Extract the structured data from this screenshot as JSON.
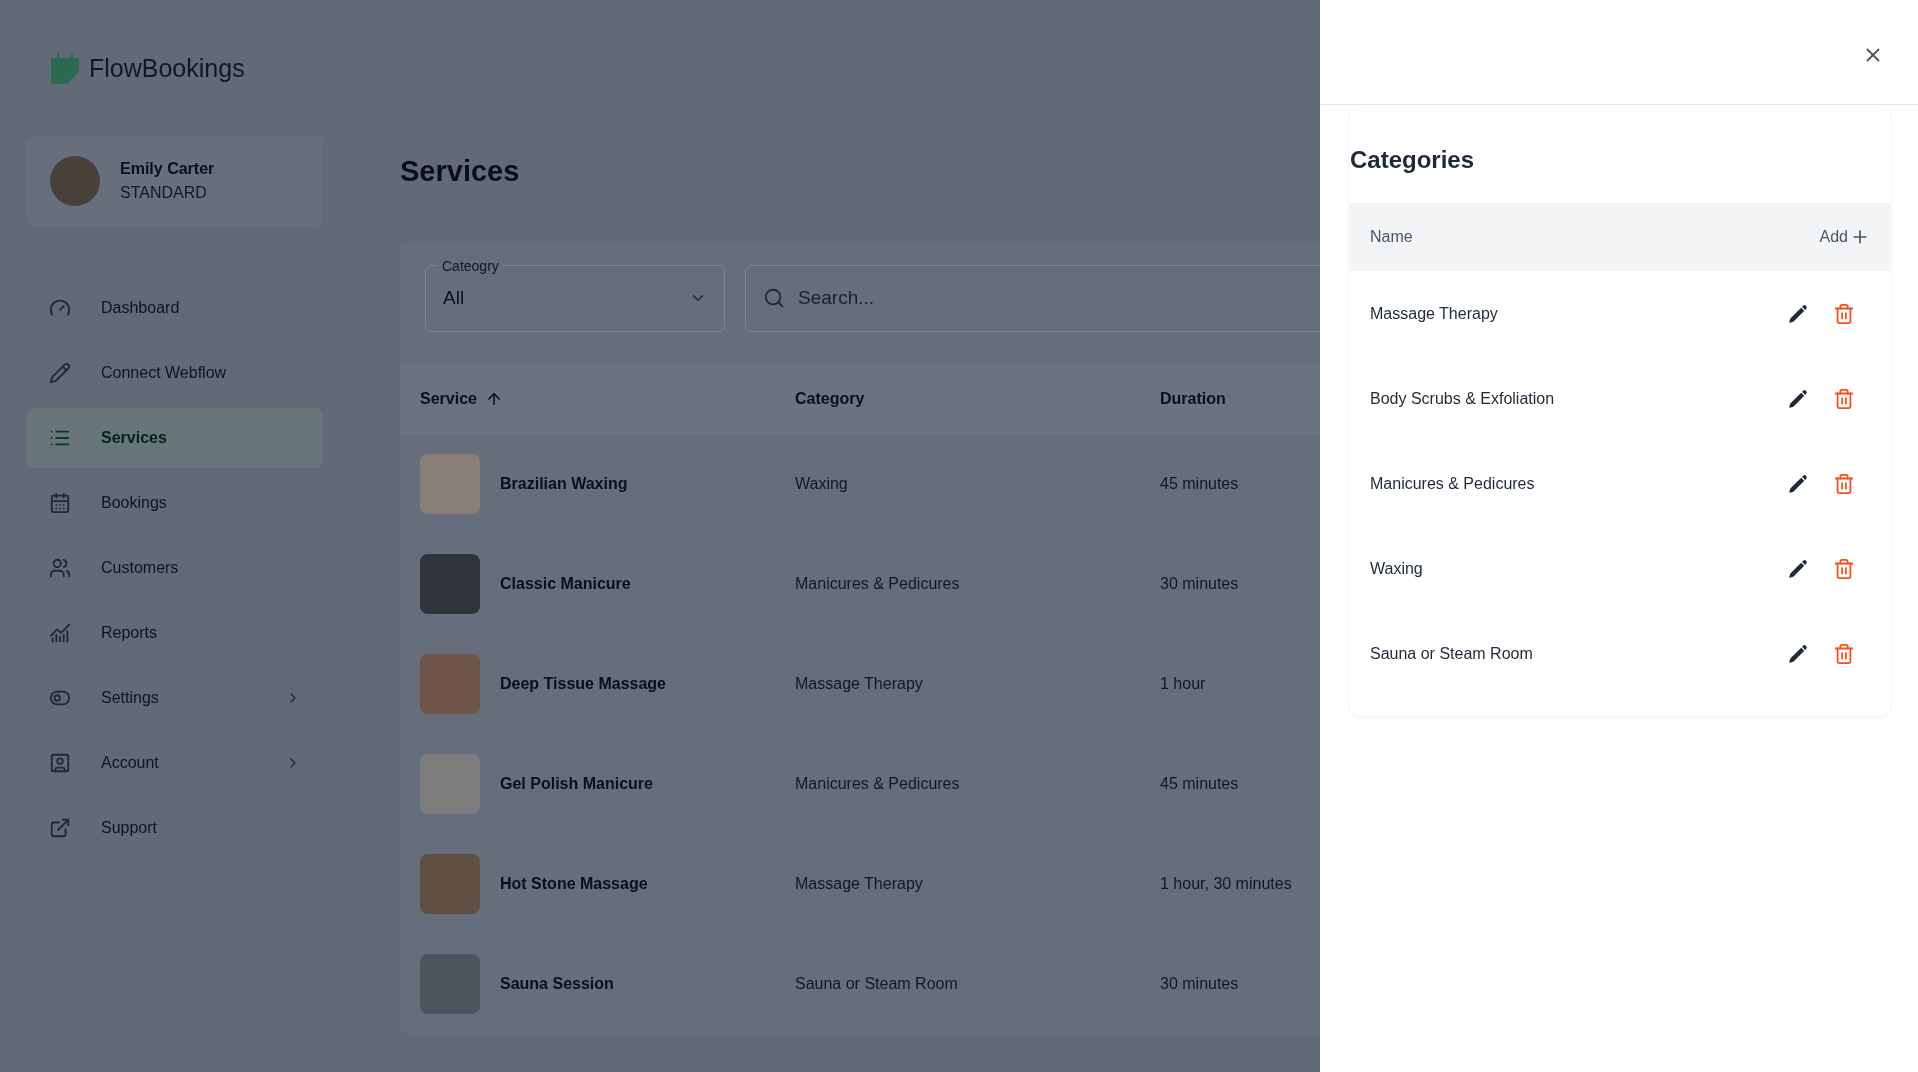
{
  "brand": {
    "name": "FlowBookings"
  },
  "user": {
    "name": "Emily Carter",
    "plan": "STANDARD"
  },
  "nav": [
    {
      "label": "Dashboard",
      "kind": "dashboard",
      "selected": false,
      "has_submenu": false
    },
    {
      "label": "Connect Webflow",
      "kind": "connect",
      "selected": false,
      "has_submenu": false
    },
    {
      "label": "Services",
      "kind": "services",
      "selected": true,
      "has_submenu": false
    },
    {
      "label": "Bookings",
      "kind": "bookings",
      "selected": false,
      "has_submenu": false
    },
    {
      "label": "Customers",
      "kind": "customers",
      "selected": false,
      "has_submenu": false
    },
    {
      "label": "Reports",
      "kind": "reports",
      "selected": false,
      "has_submenu": false
    },
    {
      "label": "Settings",
      "kind": "settings",
      "selected": false,
      "has_submenu": true
    },
    {
      "label": "Account",
      "kind": "account",
      "selected": false,
      "has_submenu": true
    },
    {
      "label": "Support",
      "kind": "support",
      "selected": false,
      "has_submenu": false
    }
  ],
  "page": {
    "title": "Services"
  },
  "filters": {
    "category": {
      "label": "Cateogry",
      "value": "All"
    },
    "search": {
      "placeholder": "Search..."
    }
  },
  "table": {
    "columns": [
      {
        "label": "Service",
        "sorted": true
      },
      {
        "label": "Category",
        "sorted": false
      },
      {
        "label": "Duration",
        "sorted": false
      }
    ],
    "rows": [
      {
        "service": "Brazilian Waxing",
        "category": "Waxing",
        "duration": "45 minutes",
        "color": "#8a8079"
      },
      {
        "service": "Classic Manicure",
        "category": "Manicures & Pedicures",
        "duration": "30 minutes",
        "color": "#2f343b"
      },
      {
        "service": "Deep Tissue Massage",
        "category": "Massage Therapy",
        "duration": "1 hour",
        "color": "#6e5348"
      },
      {
        "service": "Gel Polish Manicure",
        "category": "Manicures & Pedicures",
        "duration": "45 minutes",
        "color": "#7e7c7c"
      },
      {
        "service": "Hot Stone Massage",
        "category": "Massage Therapy",
        "duration": "1 hour, 30 minutes",
        "color": "#5f5043"
      },
      {
        "service": "Sauna Session",
        "category": "Sauna or Steam Room",
        "duration": "30 minutes",
        "color": "#4c555c"
      }
    ]
  },
  "drawer": {
    "title": "Categories",
    "header": {
      "name": "Name",
      "add": "Add"
    },
    "categories": [
      {
        "name": "Massage Therapy"
      },
      {
        "name": "Body Scrubs & Exfoliation"
      },
      {
        "name": "Manicures & Pedicures"
      },
      {
        "name": "Waxing"
      },
      {
        "name": "Sauna or Steam Room"
      }
    ]
  }
}
